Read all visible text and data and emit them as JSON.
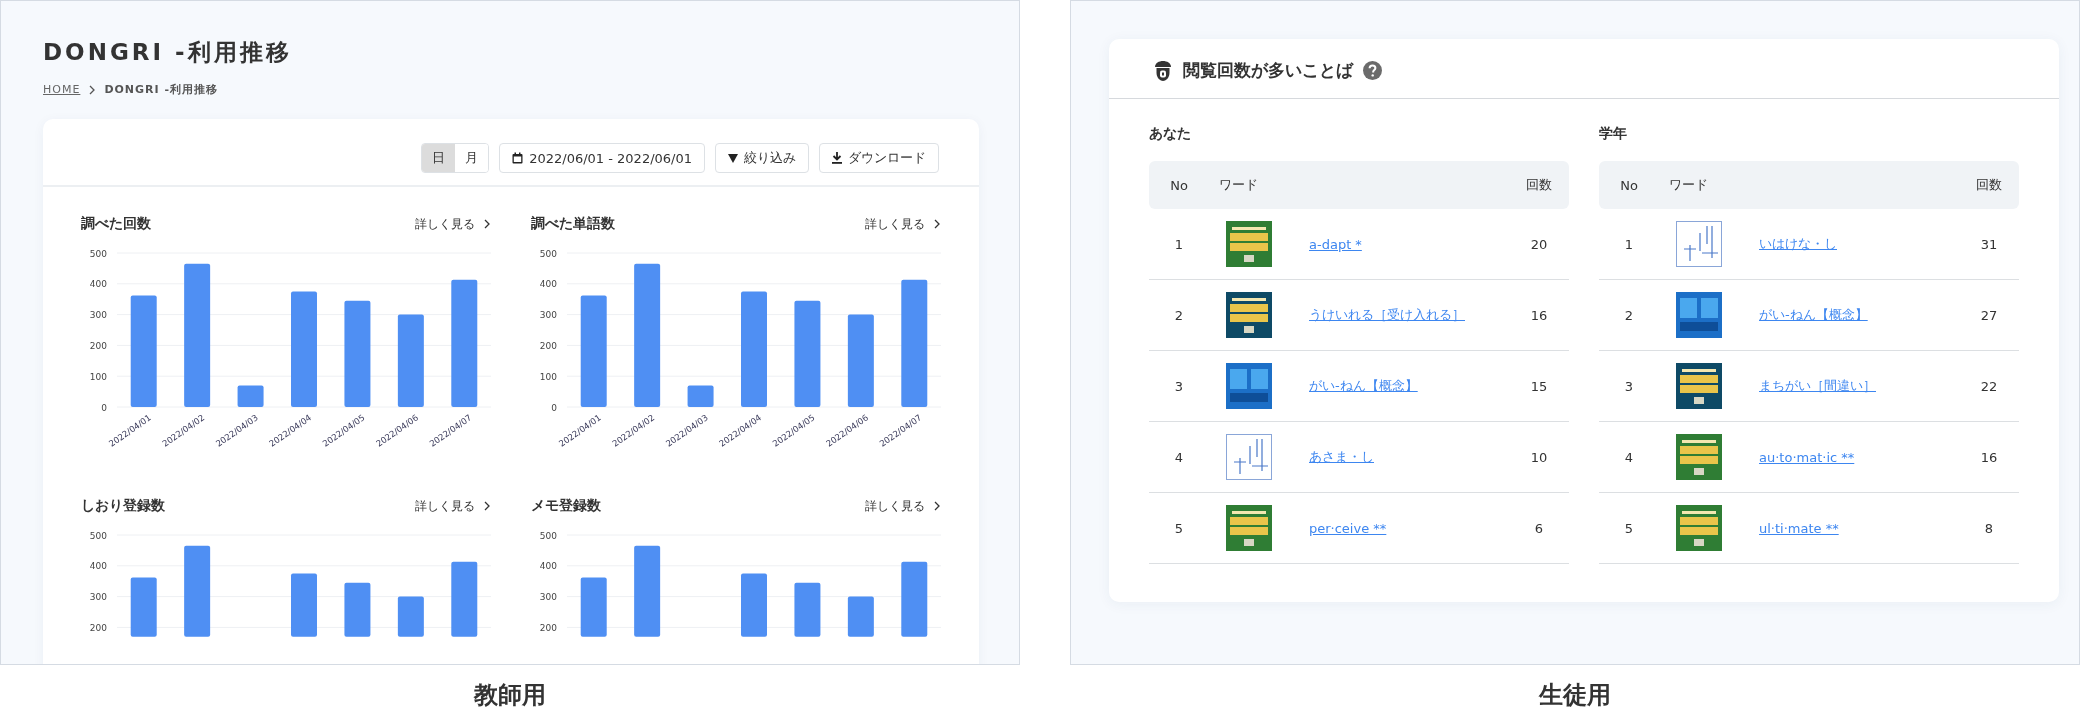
{
  "teacher_view": {
    "page_title": "DONGRI -利用推移",
    "breadcrumb": [
      {
        "label": "HOME",
        "kind": "link"
      },
      {
        "label": "DONGRI -利用推移",
        "kind": "current"
      }
    ],
    "toolbar": {
      "period_toggle": [
        {
          "label": "日",
          "selected": true
        },
        {
          "label": "月",
          "selected": false
        }
      ],
      "date_range": "2022/06/01 - 2022/06/01",
      "filter_button": "絞り込み",
      "download_button": "ダウンロード"
    },
    "charts": [
      {
        "title": "調べた回数",
        "more_link": "詳しく見る",
        "chart_data": {
          "type": "bar",
          "categories": [
            "2022/04/01",
            "2022/04/02",
            "2022/04/03",
            "2022/04/04",
            "2022/04/05",
            "2022/04/06",
            "2022/04/07"
          ],
          "values": [
            362,
            465,
            70,
            375,
            345,
            300,
            413
          ],
          "ylim": [
            0,
            500
          ],
          "yticks": [
            0,
            100,
            200,
            300,
            400,
            500
          ],
          "grid": true
        }
      },
      {
        "title": "調べた単語数",
        "more_link": "詳しく見る",
        "chart_data": {
          "type": "bar",
          "categories": [
            "2022/04/01",
            "2022/04/02",
            "2022/04/03",
            "2022/04/04",
            "2022/04/05",
            "2022/04/06",
            "2022/04/07"
          ],
          "values": [
            362,
            465,
            70,
            375,
            345,
            300,
            413
          ],
          "ylim": [
            0,
            500
          ],
          "yticks": [
            0,
            100,
            200,
            300,
            400,
            500
          ],
          "grid": true
        }
      },
      {
        "title": "しおり登録数",
        "more_link": "詳しく見る",
        "chart_data": {
          "type": "bar",
          "values": [
            362,
            465,
            null,
            375,
            345,
            300,
            413
          ],
          "ylim": [
            170,
            500
          ],
          "yticks": [
            200,
            300,
            400,
            500
          ],
          "grid": true
        }
      },
      {
        "title": "メモ登録数",
        "more_link": "詳しく見る",
        "chart_data": {
          "type": "bar",
          "values": [
            362,
            465,
            null,
            375,
            345,
            300,
            413
          ],
          "ylim": [
            170,
            500
          ],
          "yticks": [
            200,
            300,
            400,
            500
          ],
          "grid": true
        }
      }
    ],
    "caption": "教師用"
  },
  "student_view": {
    "section_title": "閲覧回数が多いことば",
    "rankings": [
      {
        "heading": "あなた",
        "columns": [
          "No",
          "ワード",
          "回数"
        ],
        "rows": [
          {
            "no": "1",
            "kind": "genius-g5",
            "word": "a-dapt *",
            "count": "20"
          },
          {
            "no": "2",
            "kind": "genius-g3",
            "word": "うけいれる［受け入れる］",
            "count": "16"
          },
          {
            "no": "3",
            "kind": "meikyo",
            "word": "がい-ねん【概念】",
            "count": "15"
          },
          {
            "no": "4",
            "kind": "kogo",
            "word": "あさま・し",
            "count": "10"
          },
          {
            "no": "5",
            "kind": "genius-g5",
            "word": "per·ceive **",
            "count": "6"
          }
        ]
      },
      {
        "heading": "学年",
        "columns": [
          "No",
          "ワード",
          "回数"
        ],
        "rows": [
          {
            "no": "1",
            "kind": "kogo",
            "word": "いはけな・し",
            "count": "31"
          },
          {
            "no": "2",
            "kind": "meikyo",
            "word": "がい-ねん【概念】",
            "count": "27"
          },
          {
            "no": "3",
            "kind": "genius-g3",
            "word": "まちがい［間違い］",
            "count": "22"
          },
          {
            "no": "4",
            "kind": "genius-g5",
            "word": "au·to·mat·ic **",
            "count": "16"
          },
          {
            "no": "5",
            "kind": "genius-g5",
            "word": "ul·ti·mate **",
            "count": "8"
          }
        ]
      }
    ],
    "caption": "生徒用"
  }
}
